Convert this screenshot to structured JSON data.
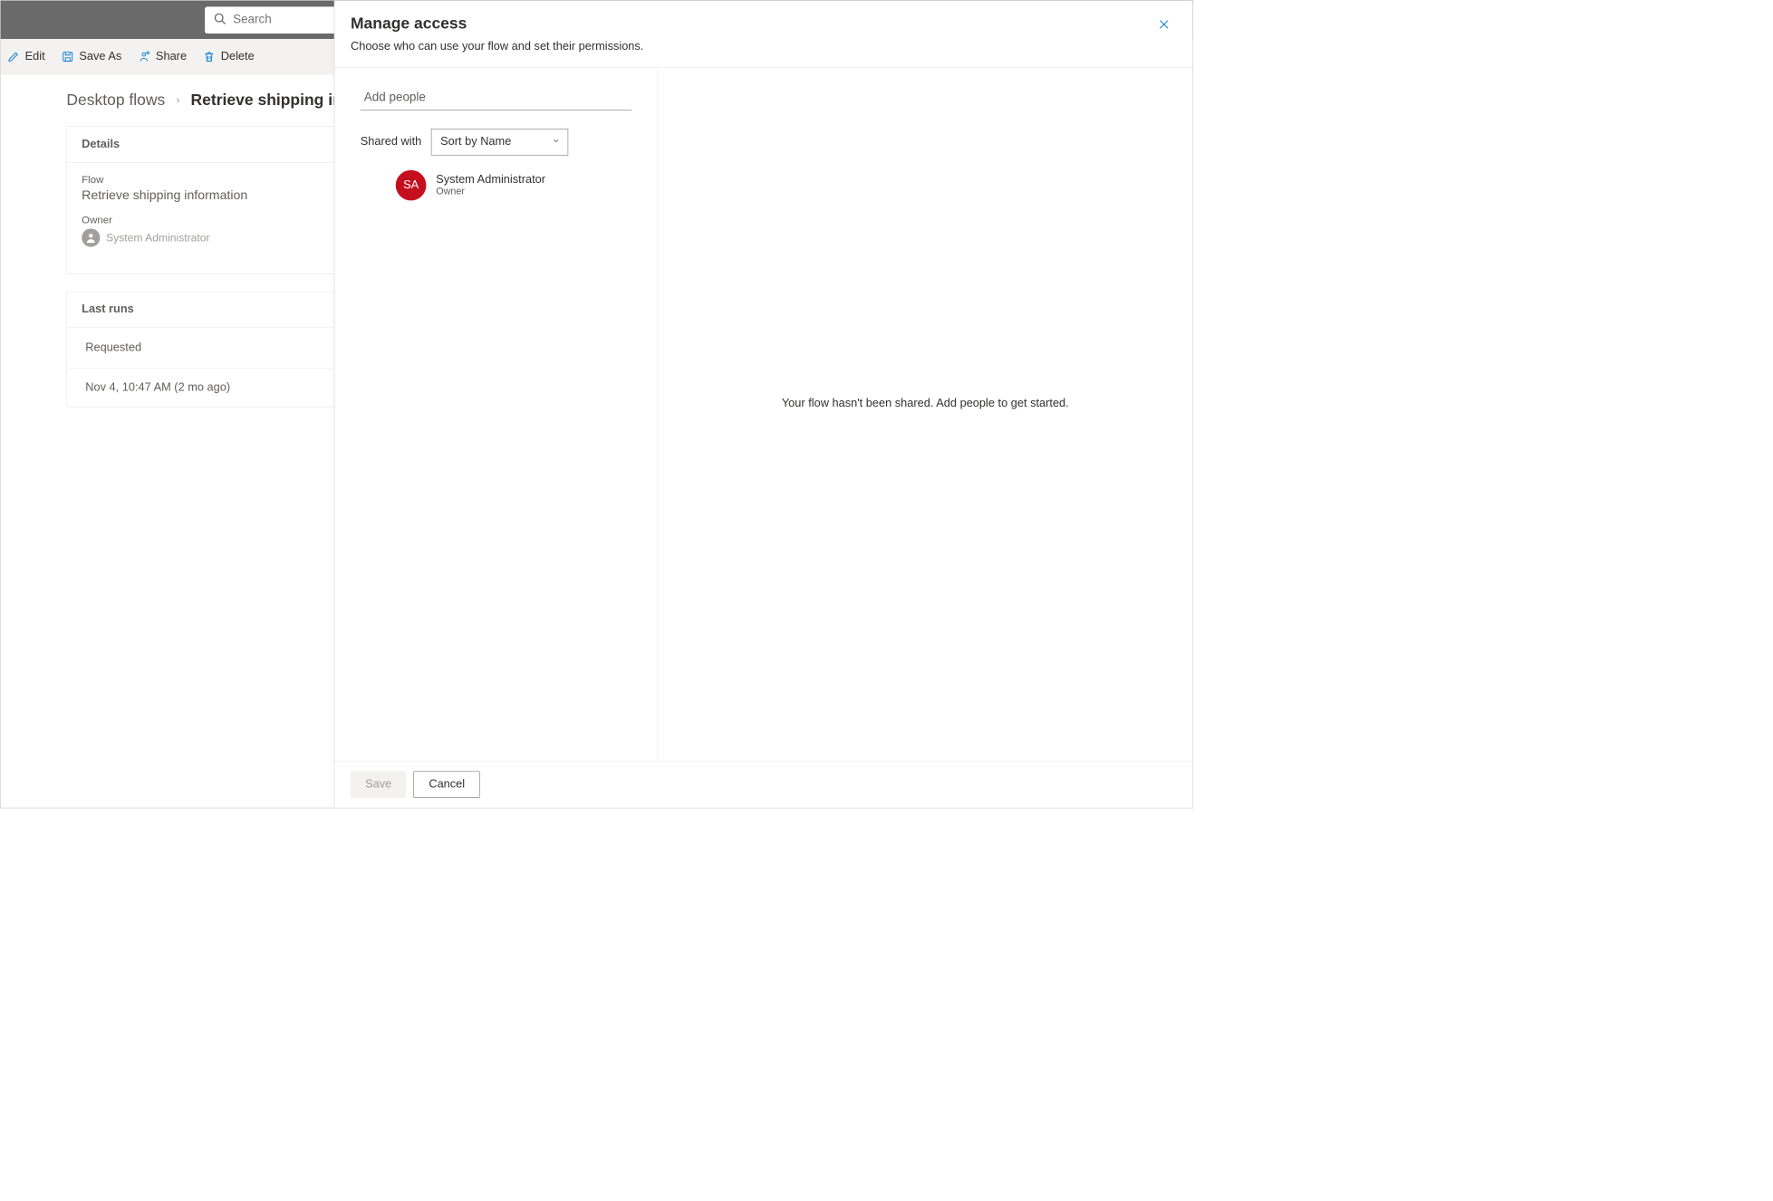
{
  "search": {
    "placeholder": "Search"
  },
  "commands": {
    "edit": "Edit",
    "saveAs": "Save As",
    "share": "Share",
    "delete": "Delete"
  },
  "breadcrumb": {
    "parent": "Desktop flows",
    "current": "Retrieve shipping information"
  },
  "details": {
    "title": "Details",
    "flowLabel": "Flow",
    "flowName": "Retrieve shipping information",
    "ownerLabel": "Owner",
    "ownerName": "System Administrator"
  },
  "lastRuns": {
    "title": "Last runs",
    "column": "Requested",
    "rows": [
      "Nov 4, 10:47 AM (2 mo ago)"
    ]
  },
  "panel": {
    "title": "Manage access",
    "subtitle": "Choose who can use your flow and set their permissions.",
    "addPeoplePlaceholder": "Add people",
    "sharedWithLabel": "Shared with",
    "sortSelected": "Sort by Name",
    "person": {
      "initials": "SA",
      "name": "System Administrator",
      "role": "Owner"
    },
    "emptyMessage": "Your flow hasn't been shared. Add people to get started.",
    "saveLabel": "Save",
    "cancelLabel": "Cancel"
  }
}
